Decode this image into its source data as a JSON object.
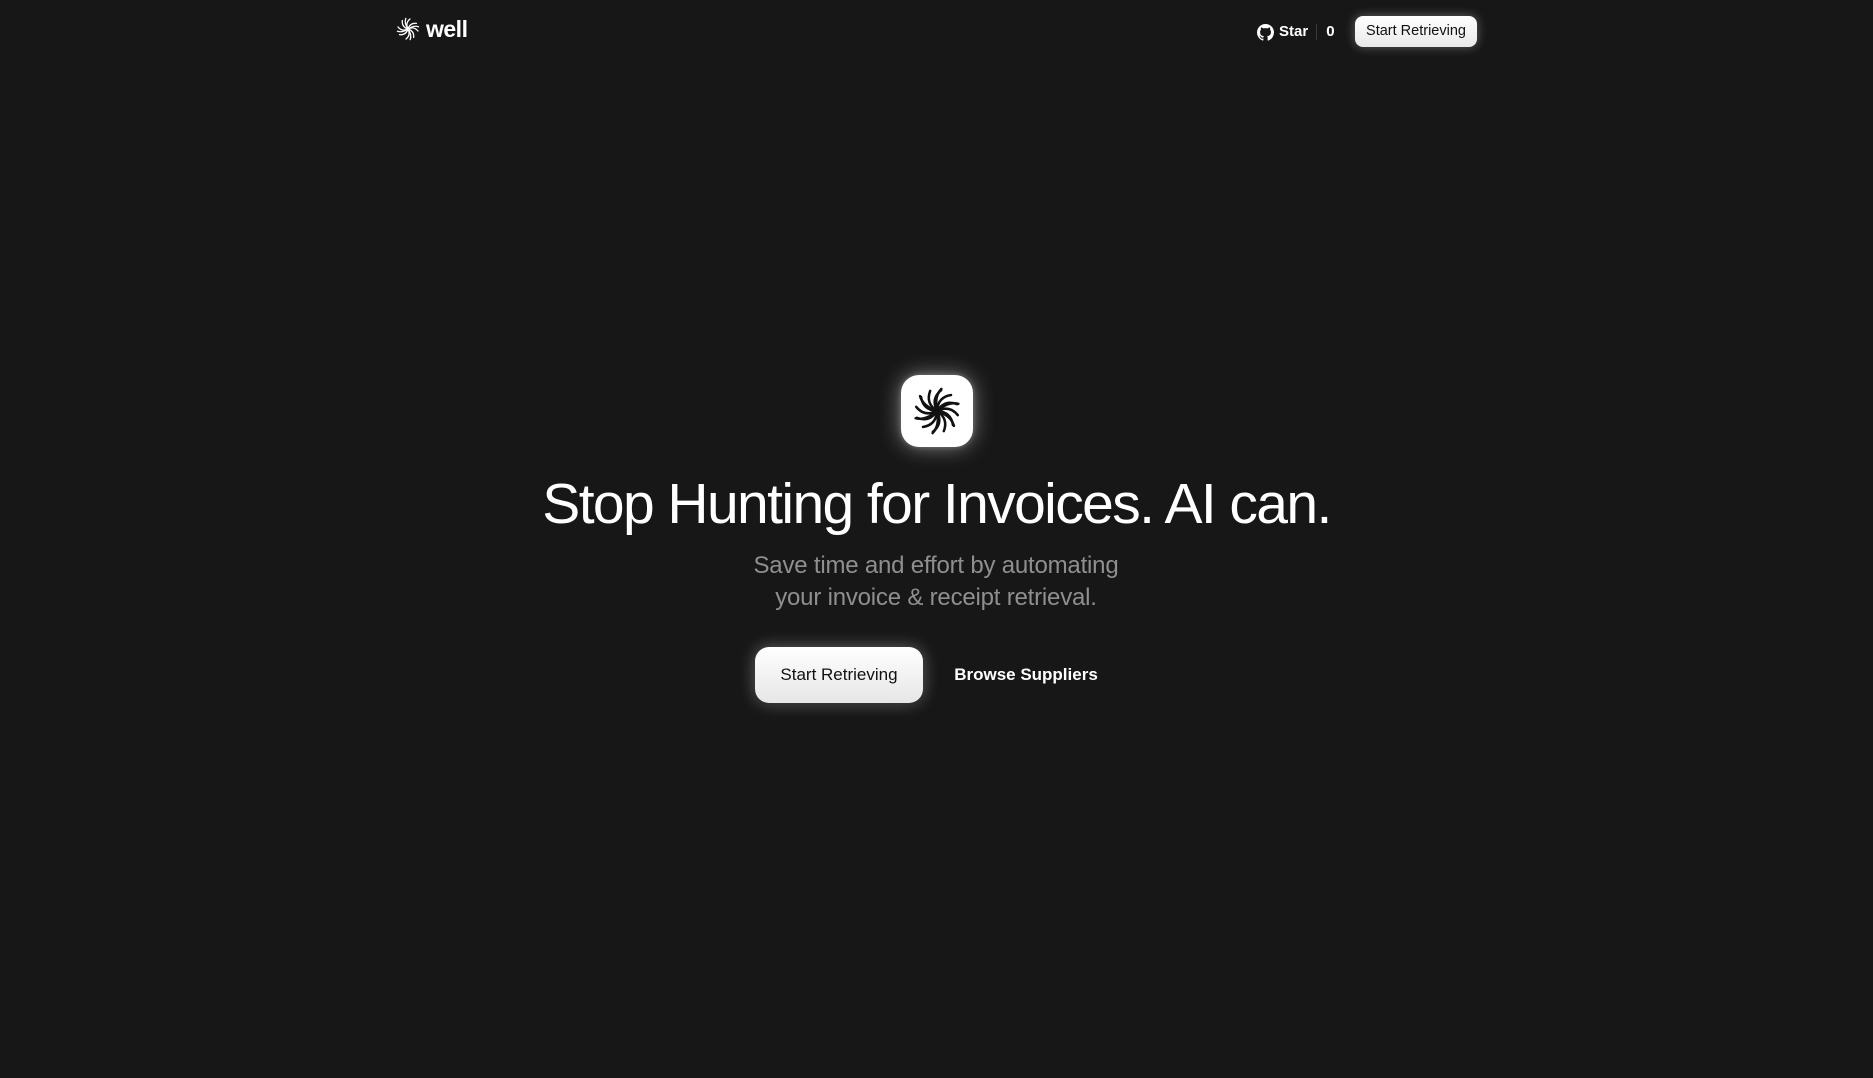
{
  "header": {
    "brand_name": "well",
    "brand_logo_icon": "spiral-logo-icon",
    "github": {
      "icon": "github-icon",
      "star_label": "Star",
      "star_count": "0"
    },
    "cta_label": "Start Retrieving"
  },
  "hero": {
    "app_icon": "spiral-logo-icon",
    "title": "Stop Hunting for Invoices. AI can.",
    "subtitle_line1": "Save time and effort by automating",
    "subtitle_line2": "your invoice & receipt retrieval.",
    "primary_cta_label": "Start Retrieving",
    "secondary_cta_label": "Browse Suppliers"
  },
  "colors": {
    "background": "#171717",
    "text_primary": "#ffffff",
    "text_muted": "#8f8f8f",
    "button_bg": "#ffffff",
    "button_text": "#111111"
  }
}
